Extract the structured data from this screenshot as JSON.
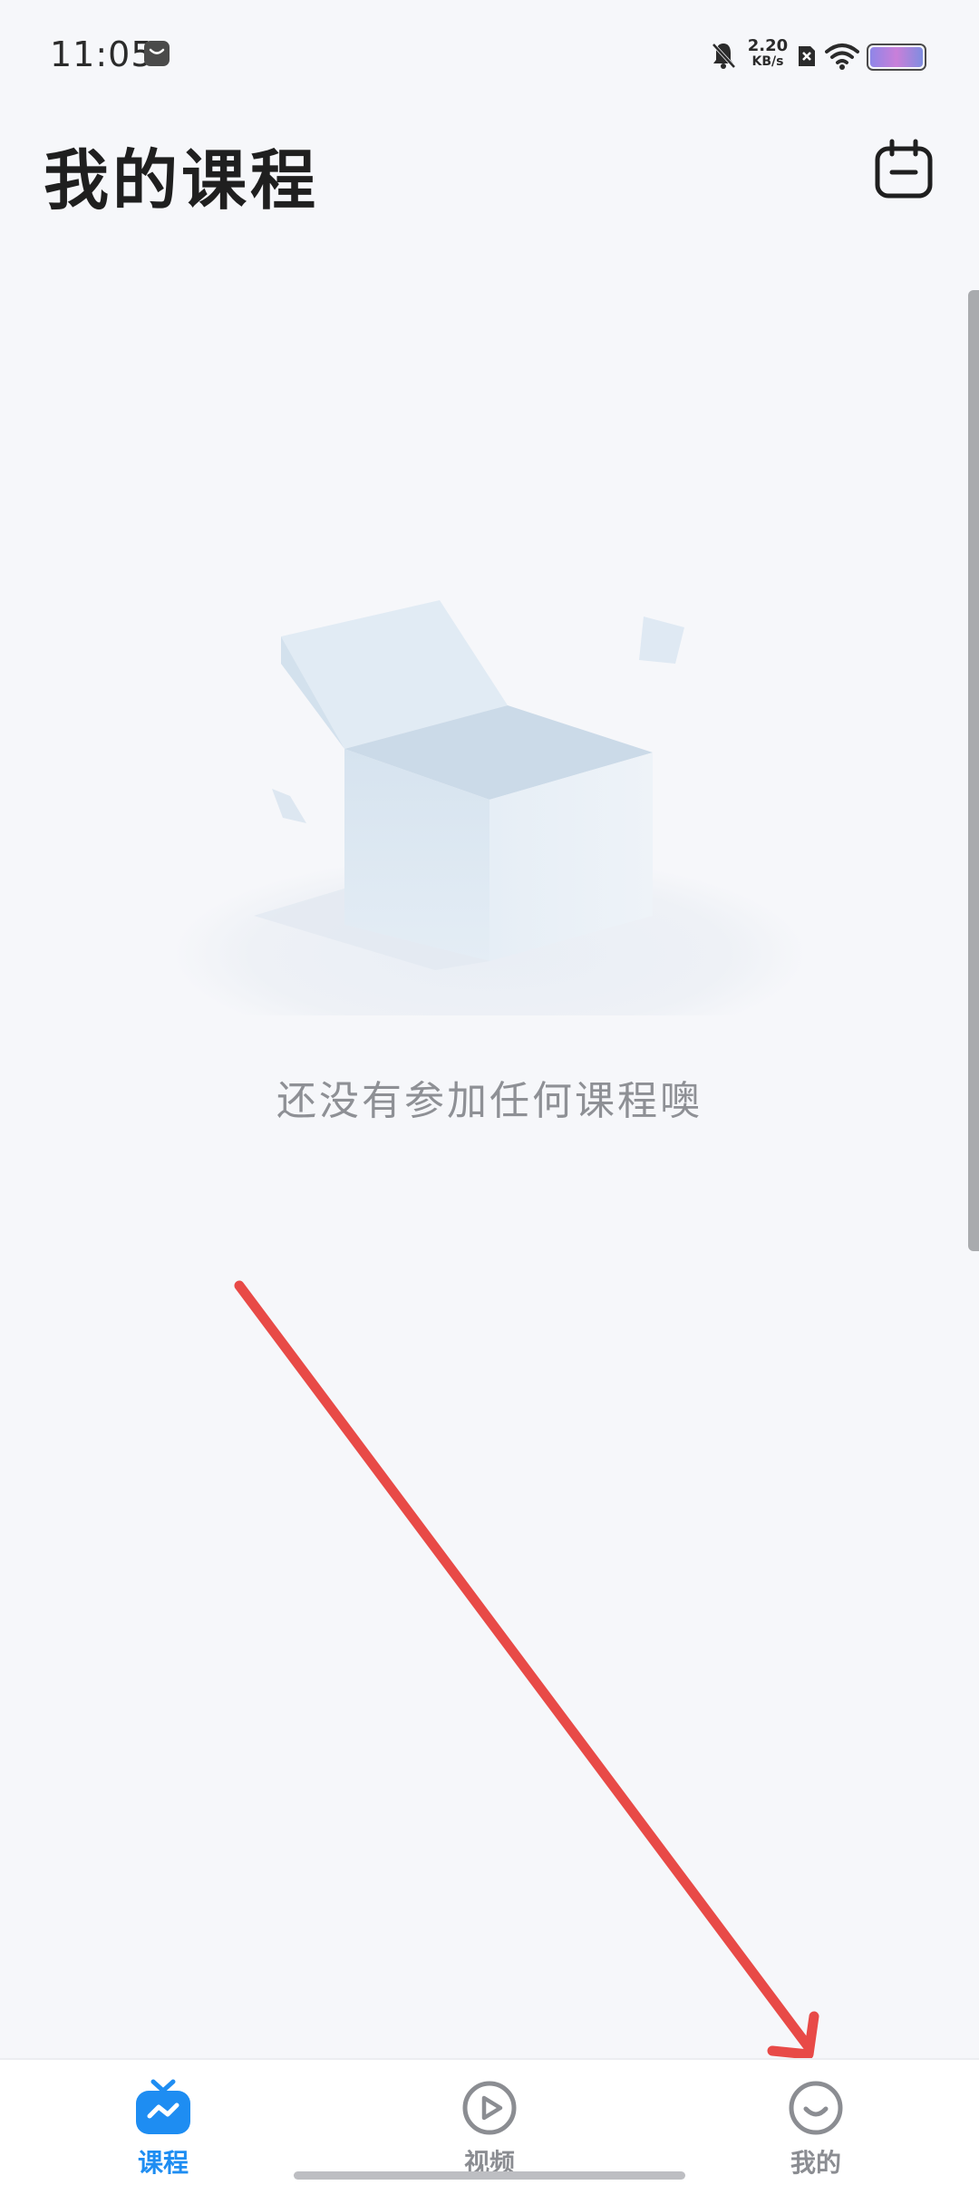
{
  "status_bar": {
    "time": "11:05",
    "network_speed": "2.20",
    "network_speed_unit": "KB/s",
    "icons": [
      "notification-icon",
      "mute-icon",
      "sim-off-icon",
      "wifi-icon",
      "battery-icon"
    ]
  },
  "header": {
    "title": "我的课程",
    "action_icon": "calendar-icon"
  },
  "empty_state": {
    "illustration": "empty-box",
    "message": "还没有参加任何课程噢"
  },
  "tabbar": {
    "active_color": "#1e8df2",
    "inactive_color": "#8b8d92",
    "tabs": [
      {
        "label": "课程",
        "icon": "course-tv-icon",
        "active": true
      },
      {
        "label": "视频",
        "icon": "video-play-icon",
        "active": false
      },
      {
        "label": "我的",
        "icon": "profile-smile-icon",
        "active": false
      }
    ]
  },
  "annotation": {
    "type": "arrow",
    "color": "#e84a47"
  }
}
